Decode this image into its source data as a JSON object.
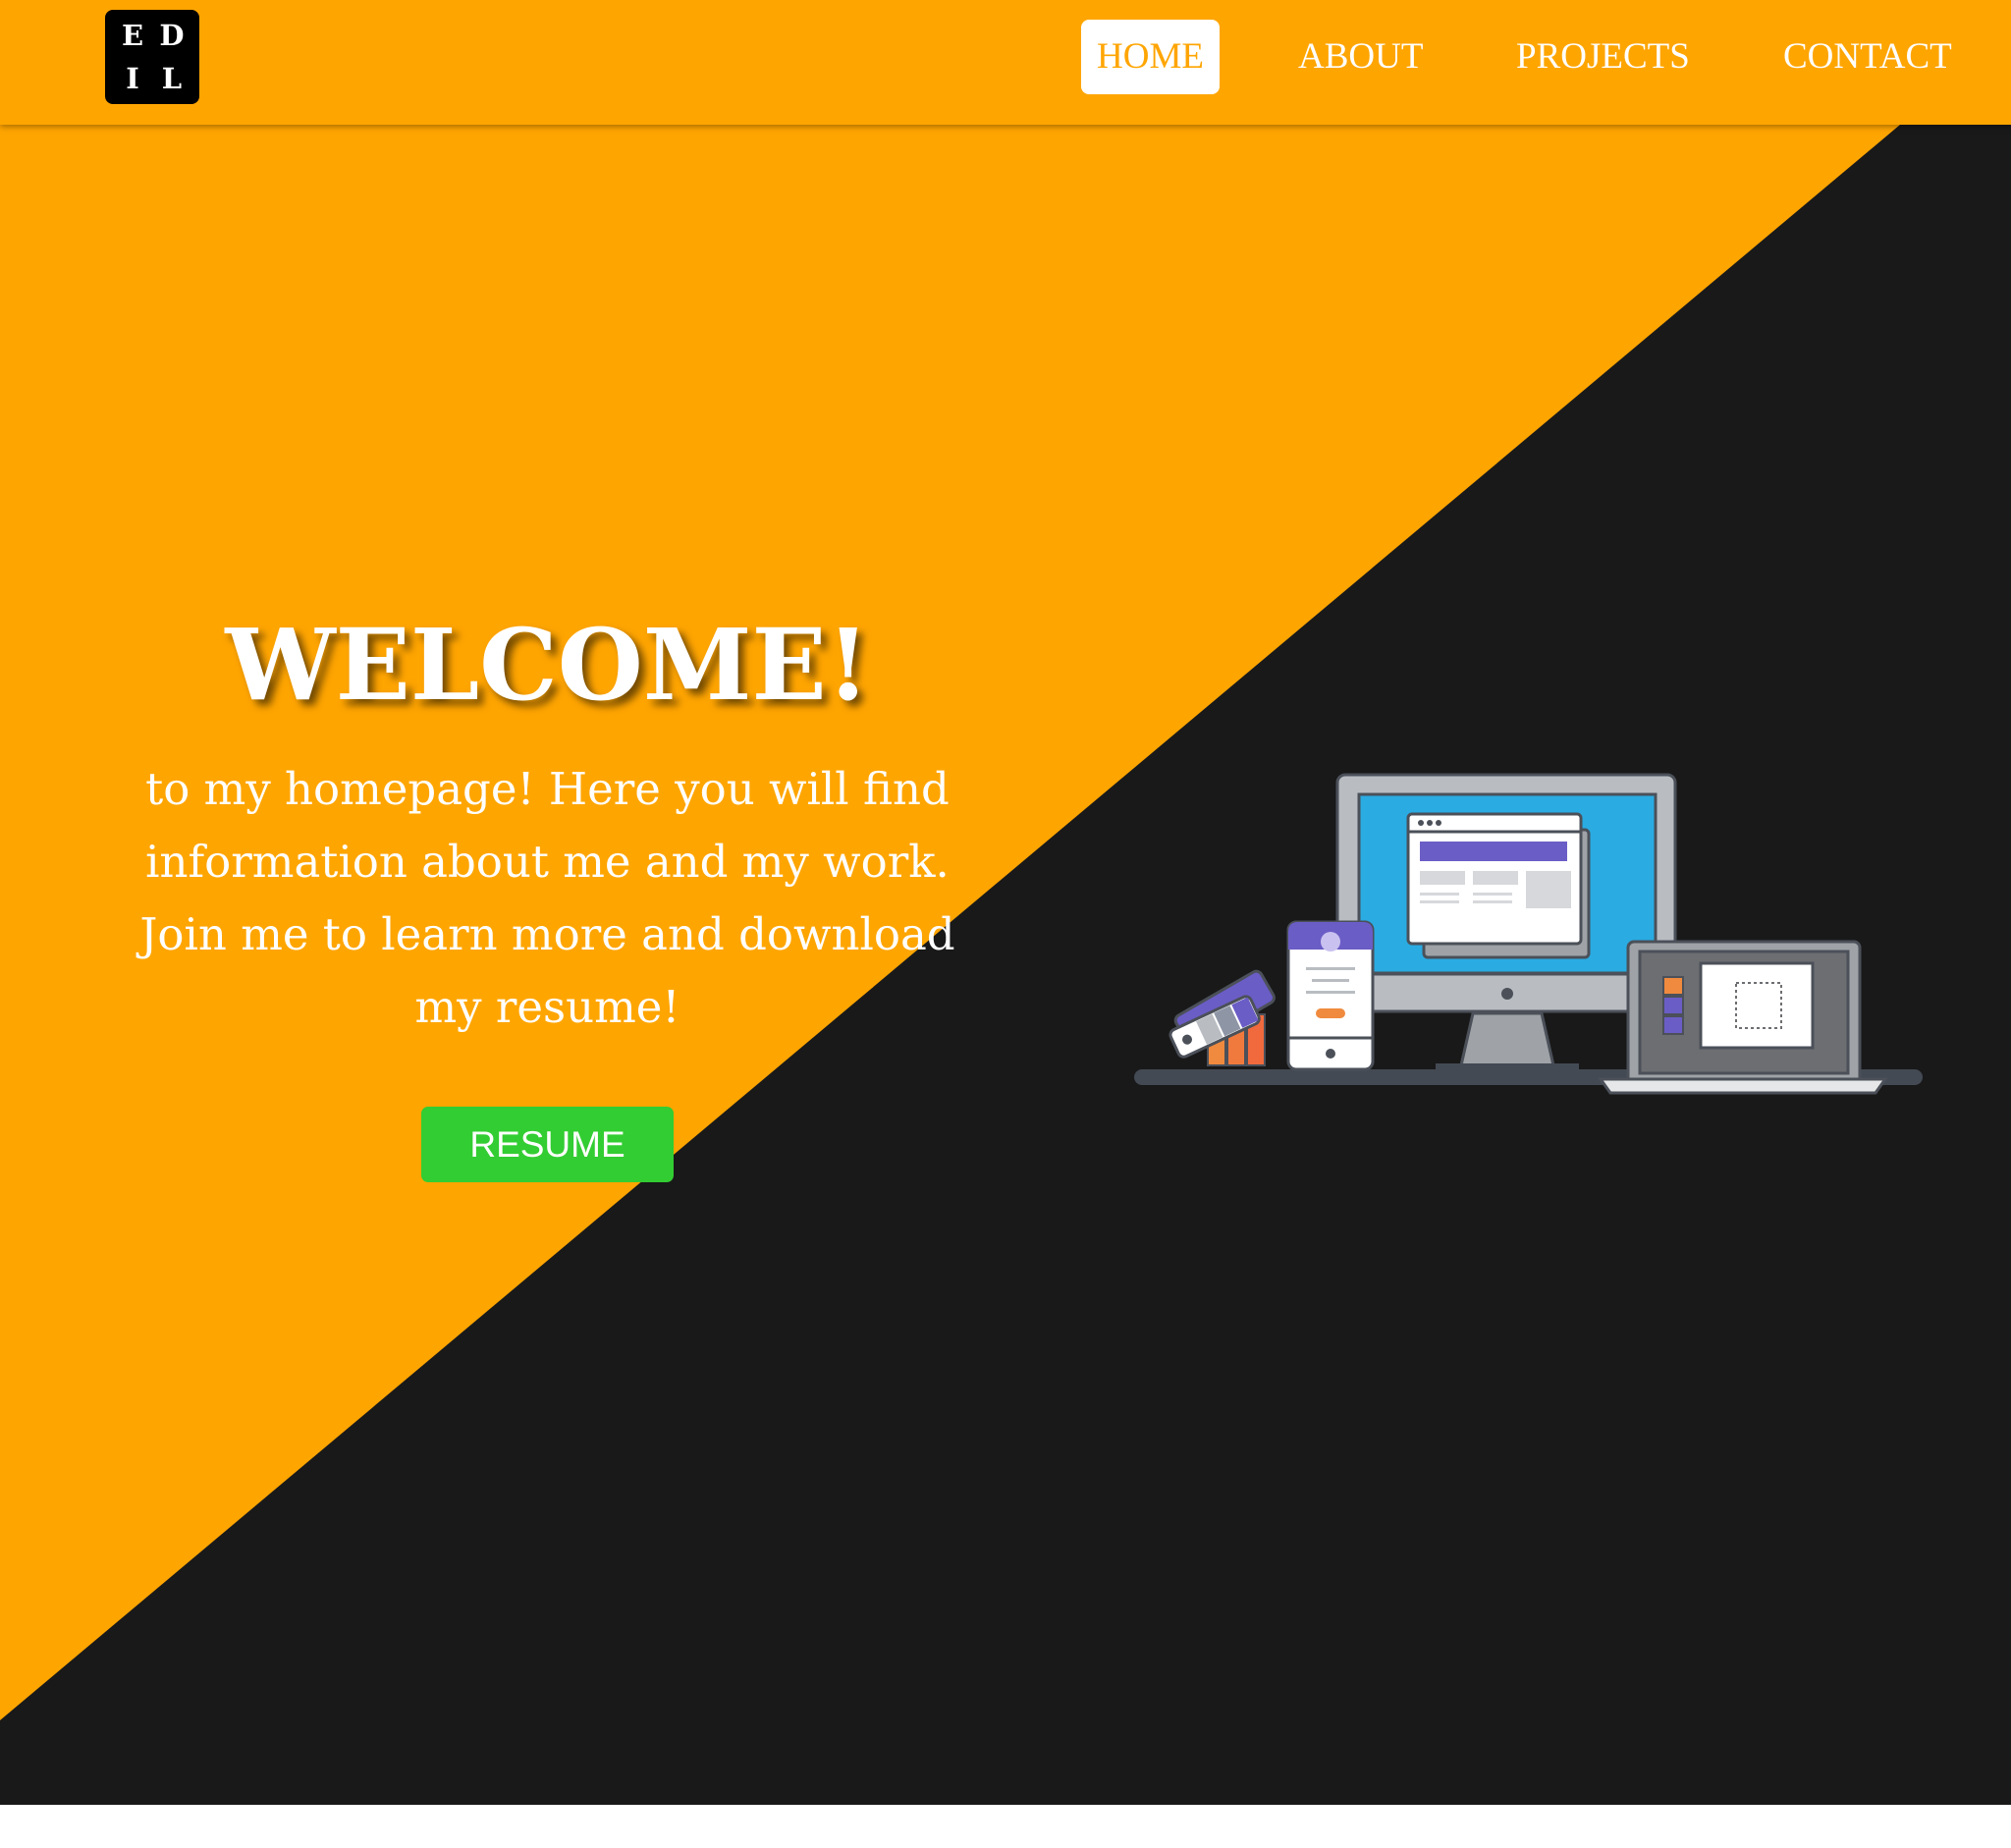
{
  "logo": {
    "letters": [
      "E",
      "D",
      "I",
      "L"
    ]
  },
  "nav": {
    "items": [
      {
        "label": "HOME",
        "active": true
      },
      {
        "label": "ABOUT",
        "active": false
      },
      {
        "label": "PROJECTS",
        "active": false
      },
      {
        "label": "CONTACT",
        "active": false
      }
    ]
  },
  "hero": {
    "title": "WELCOME!",
    "intro": "to my homepage! Here you will find information about me and my work. Join me to learn more and download my resume!",
    "resume_label": "RESUME",
    "illustration_icon": "devices-illustration-icon"
  },
  "colors": {
    "primary": "#ffa500",
    "dark": "#191919",
    "button": "#32cd32",
    "text": "#ffffff"
  }
}
